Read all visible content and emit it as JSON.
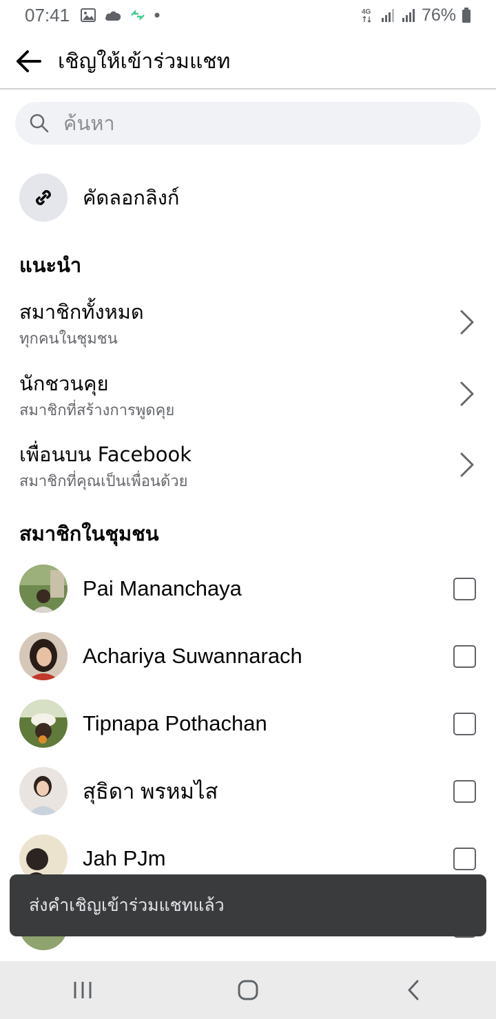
{
  "status_bar": {
    "time": "07:41",
    "network": "4G",
    "battery": "76%"
  },
  "header": {
    "title": "เชิญให้เข้าร่วมแชท"
  },
  "search": {
    "placeholder": "ค้นหา"
  },
  "copy_link": {
    "label": "คัดลอกลิงก์"
  },
  "suggestions": {
    "title": "แนะนำ",
    "items": [
      {
        "title": "สมาชิกทั้งหมด",
        "subtitle": "ทุกคนในชุมชน"
      },
      {
        "title": "นักชวนคุย",
        "subtitle": "สมาชิกที่สร้างการพูดคุย"
      },
      {
        "title": "เพื่อนบน Facebook",
        "subtitle": "สมาชิกที่คุณเป็นเพื่อนด้วย"
      }
    ]
  },
  "members": {
    "title": "สมาชิกในชุมชน",
    "items": [
      {
        "name": "Pai Mananchaya",
        "checked": false
      },
      {
        "name": "Achariya Suwannarach",
        "checked": false
      },
      {
        "name": "Tipnapa Pothachan",
        "checked": false
      },
      {
        "name": "สุธิดา พรหมไส",
        "checked": false
      },
      {
        "name": "Jah PJm",
        "checked": false
      }
    ]
  },
  "toast": {
    "text": "ส่งคำเชิญเข้าร่วมแชทแล้ว"
  },
  "icons": {
    "back": "arrow-left-icon",
    "search": "search-icon",
    "link": "link-icon",
    "chevron": "chevron-right-icon",
    "nav": [
      "recent-apps-icon",
      "home-icon",
      "back-nav-icon"
    ]
  },
  "colors": {
    "search_bg": "#f0f2f5",
    "toast_bg": "#3a3b3c",
    "secondary_text": "#65676b"
  }
}
